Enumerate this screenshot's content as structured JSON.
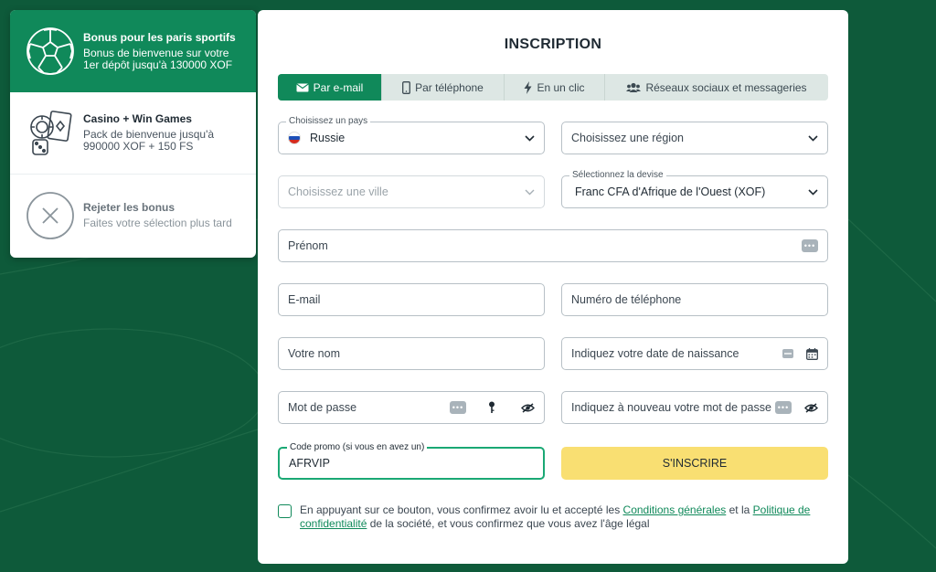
{
  "bonus": {
    "items": [
      {
        "title": "Bonus pour les paris sportifs",
        "desc": "Bonus de bienvenue sur votre 1er dépôt jusqu'à 130000 XOF",
        "icon": "soccer-ball-icon"
      },
      {
        "title": "Casino + Win Games",
        "desc": "Pack de bienvenue jusqu'à 990000 XOF + 150 FS",
        "icon": "casino-chip-cards-icon"
      },
      {
        "title": "Rejeter les bonus",
        "desc": "Faites votre sélection plus tard",
        "icon": "close-circle-icon"
      }
    ]
  },
  "form": {
    "title": "INSCRIPTION",
    "tabs": [
      {
        "label": "Par e-mail",
        "icon": "envelope-icon"
      },
      {
        "label": "Par téléphone",
        "icon": "phone-icon"
      },
      {
        "label": "En un clic",
        "icon": "lightning-icon"
      },
      {
        "label": "Réseaux sociaux et messageries",
        "icon": "users-icon"
      }
    ],
    "country": {
      "legend": "Choisissez un pays",
      "value": "Russie"
    },
    "region": {
      "placeholder": "Choisissez une région"
    },
    "city": {
      "placeholder": "Choisissez une ville"
    },
    "currency": {
      "legend": "Sélectionnez la devise",
      "value": "Franc CFA d'Afrique de l'Ouest (XOF)"
    },
    "firstname": {
      "placeholder": "Prénom"
    },
    "email": {
      "placeholder": "E-mail"
    },
    "phone": {
      "placeholder": "Numéro de téléphone"
    },
    "lastname": {
      "placeholder": "Votre nom"
    },
    "birthdate": {
      "placeholder": "Indiquez votre date de naissance"
    },
    "password": {
      "placeholder": "Mot de passe"
    },
    "password_confirm": {
      "placeholder": "Indiquez à nouveau votre mot de passe"
    },
    "promo": {
      "legend": "Code promo (si vous en avez un)",
      "value": "AFRVIP"
    },
    "submit_label": "S'INSCRIRE",
    "consent": {
      "text_before": "En appuyant sur ce bouton, vous confirmez avoir lu et accepté les ",
      "link_terms": "Conditions générales",
      "text_middle": " et la ",
      "link_privacy": "Politique de confidentialité",
      "text_after": " de la société, et vous confirmez que vous avez l'âge légal"
    }
  },
  "colors": {
    "background": "#0e5a3a",
    "accent": "#10895a",
    "submit": "#f9df72"
  }
}
